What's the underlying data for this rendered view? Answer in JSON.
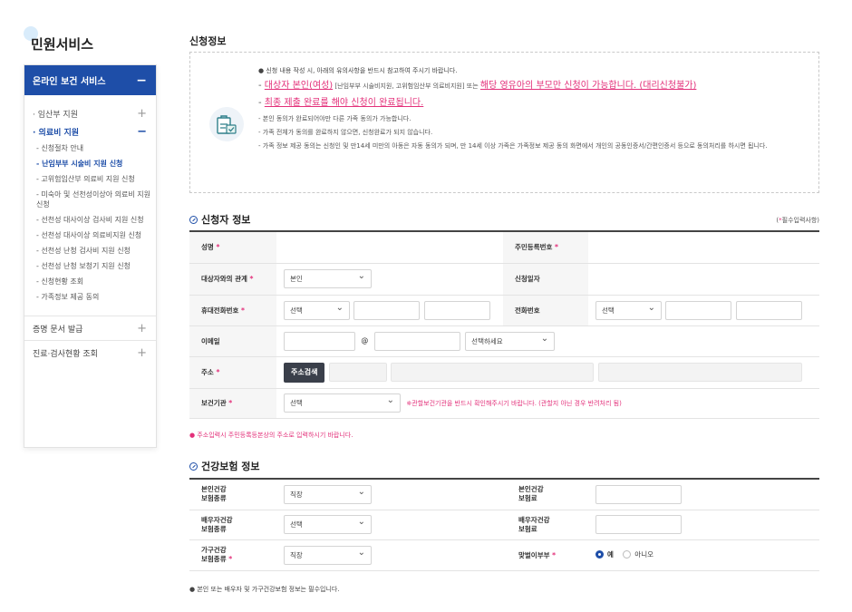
{
  "sidebar": {
    "title": "민원서비스",
    "section_label": "온라인 보건 서비스",
    "section_toggle": "−",
    "items": [
      {
        "label": "· 임산부 지원",
        "toggle": "+"
      },
      {
        "label": "· 의료비 지원",
        "toggle": "−"
      }
    ],
    "subitems": [
      "- 신청절차 안내",
      "- 난임부부 시술비 지원 신청",
      "- 고위험임산부 의료비 지원 신청",
      "- 미숙아 및 선천성이상아 의료비 지원 신청",
      "- 선천성 대사이상 검사비 지원 신청",
      "- 선천성 대사이상 의료비지원 신청",
      "- 선천성 난청 검사비 지원 신청",
      "- 선천성 난청 보청기 지원 신청",
      "- 신청현황 조회",
      "- 가족정보 제공 동의"
    ],
    "bottom_items": [
      {
        "label": "증명 문서 발급",
        "toggle": "+"
      },
      {
        "label": "진료·검사현황 조회",
        "toggle": "+"
      }
    ]
  },
  "main": {
    "title": "신청정보",
    "notice": {
      "line1": "신청 내용 작성 시, 아래의 유의사항을 반드시 참고하여 주시기 바랍니다.",
      "line2_prefix": "- ",
      "line2_pink1": "대상자 본인(여성)",
      "line2_mid": " [난임부부 시술비지원, 고위험임산부 의료비지원] 또는 ",
      "line2_pink2": "해당 영유아의 부모만 신청이 가능합니다. (대리신청불가)",
      "line3_prefix": "- ",
      "line3_pink": "최종 제출 완료를 해야 신청이 완료됩니다.",
      "line4": "- 본인 동의가 완료되어야만 다른 가족 동의가 가능합니다.",
      "line5": "- 가족 전체가 동의를 완료하지 않으면, 신청완료가 되지 않습니다.",
      "line6": "- 가족 정보 제공 동의는 신청인 및 만14세 미만의 아동은 자동 동의가 되며, 만 14세 이상 가족은 가족정보 제공 동의 화면에서 개인의 공동인증서/간편인증서 등으로 동의처리를 하시면 됩니다."
    }
  },
  "applicant": {
    "section_title": "신청자 정보",
    "required_note_open": "(",
    "required_star": "*",
    "required_note": "필수입력사항)",
    "name_label": "성명",
    "rrn_label": "주민등록번호",
    "relation_label": "대상자와의 관계",
    "relation_value": "본인",
    "date_label": "신청일자",
    "mobile_label": "휴대전화번호",
    "mobile_select": "선택",
    "phone_label": "전화번호",
    "phone_select": "선택",
    "email_label": "이메일",
    "email_at": "@",
    "email_select": "선택하세요",
    "address_label": "주소",
    "address_button": "주소검색",
    "center_label": "보건기관",
    "center_select": "선택",
    "center_warn": "※관할보건기관을 반드시 확인해주시기 바랍니다. (관할지 아닌 경우 반려처리 됨)",
    "address_note": "주소입력시 주민등록등본상의 주소로 입력하시기 바랍니다."
  },
  "insurance": {
    "section_title": "건강보험 정보",
    "self_type_label": "본인건강\n보험종류",
    "self_type_value": "직장",
    "self_fee_label": "본인건강\n보험료",
    "spouse_type_label": "배우자건강\n보험종류",
    "spouse_type_value": "선택",
    "spouse_fee_label": "배우자건강\n보험료",
    "household_type_label": "가구건강\n보험종류",
    "household_type_value": "직장",
    "dual_income_label": "맞벌이부부",
    "radio_yes": "예",
    "radio_no": "아니오",
    "footnote": "본인 또는 배우자 및 가구건강보험 정보는 필수입니다."
  },
  "colors": {
    "primary": "#1e4ea8",
    "accent": "#e3307a"
  }
}
